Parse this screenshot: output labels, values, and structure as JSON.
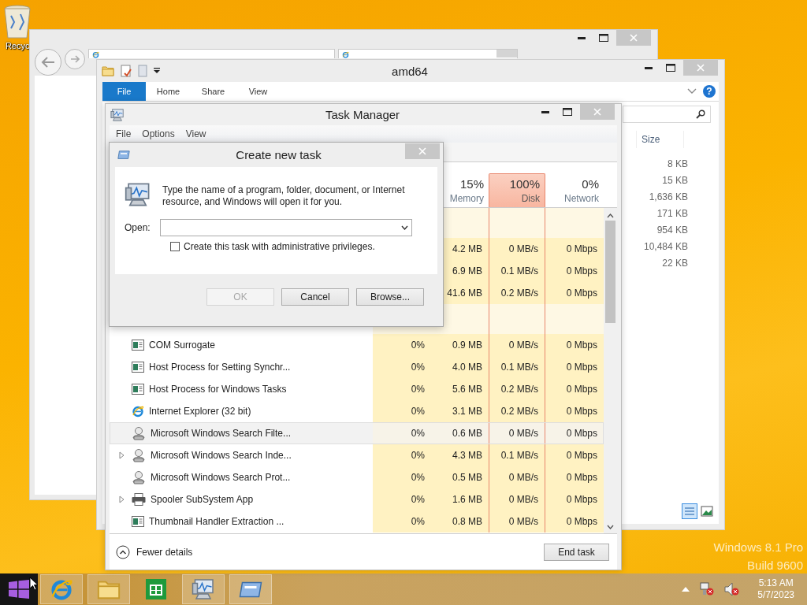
{
  "desktop": {
    "icons": [
      {
        "label": "Recyc"
      }
    ],
    "watermark": [
      "Windows 8.1 Pro",
      "Build 9600"
    ]
  },
  "explorer": {
    "title": "amd64",
    "ribbon_tabs": [
      {
        "label": "File",
        "selected": true
      },
      {
        "label": "Home",
        "selected": false
      },
      {
        "label": "Share",
        "selected": false
      },
      {
        "label": "View",
        "selected": false
      }
    ],
    "help_button": "?",
    "size_header": "Size",
    "sizes": [
      "8 KB",
      "15 KB",
      "1,636 KB",
      "171 KB",
      "954 KB",
      "10,484 KB",
      "22 KB"
    ]
  },
  "task_manager": {
    "title": "Task Manager",
    "menu": [
      "File",
      "Options",
      "View"
    ],
    "columns": [
      {
        "percent": "15%",
        "label": "Memory",
        "highlighted": false
      },
      {
        "percent": "100%",
        "label": "Disk",
        "highlighted": true
      },
      {
        "percent": "0%",
        "label": "Network",
        "highlighted": false
      }
    ],
    "groups": [
      {
        "rows": [
          {
            "selected": false,
            "memory": "4.2 MB",
            "disk": "0 MB/s",
            "network": "0 Mbps"
          },
          {
            "selected": false,
            "memory": "6.9 MB",
            "disk": "0.1 MB/s",
            "network": "0 Mbps"
          },
          {
            "selected": false,
            "memory": "41.6 MB",
            "disk": "0.2 MB/s",
            "network": "0 Mbps"
          }
        ]
      },
      {
        "rows": [
          {
            "name": "COM Surrogate",
            "kind": "app",
            "expandable": false,
            "selected": false,
            "cpu": "0%",
            "memory": "0.9 MB",
            "disk": "0 MB/s",
            "network": "0 Mbps"
          },
          {
            "name": "Host Process for Setting Synchr...",
            "kind": "app",
            "expandable": false,
            "selected": false,
            "cpu": "0%",
            "memory": "4.0 MB",
            "disk": "0.1 MB/s",
            "network": "0 Mbps"
          },
          {
            "name": "Host Process for Windows Tasks",
            "kind": "app",
            "expandable": false,
            "selected": false,
            "cpu": "0%",
            "memory": "5.6 MB",
            "disk": "0.2 MB/s",
            "network": "0 Mbps"
          },
          {
            "name": "Internet Explorer (32 bit)",
            "kind": "browser",
            "expandable": false,
            "selected": false,
            "cpu": "0%",
            "memory": "3.1 MB",
            "disk": "0.2 MB/s",
            "network": "0 Mbps"
          },
          {
            "name": "Microsoft Windows Search Filte...",
            "kind": "search",
            "expandable": false,
            "selected": true,
            "cpu": "0%",
            "memory": "0.6 MB",
            "disk": "0 MB/s",
            "network": "0 Mbps"
          },
          {
            "name": "Microsoft Windows Search Inde...",
            "kind": "search",
            "expandable": true,
            "selected": false,
            "cpu": "0%",
            "memory": "4.3 MB",
            "disk": "0.1 MB/s",
            "network": "0 Mbps"
          },
          {
            "name": "Microsoft Windows Search Prot...",
            "kind": "search",
            "expandable": false,
            "selected": false,
            "cpu": "0%",
            "memory": "0.5 MB",
            "disk": "0 MB/s",
            "network": "0 Mbps"
          },
          {
            "name": "Spooler SubSystem App",
            "kind": "printer",
            "expandable": true,
            "selected": false,
            "cpu": "0%",
            "memory": "1.6 MB",
            "disk": "0 MB/s",
            "network": "0 Mbps"
          },
          {
            "name": "Thumbnail Handler Extraction ...",
            "kind": "app",
            "expandable": false,
            "selected": false,
            "cpu": "0%",
            "memory": "0.8 MB",
            "disk": "0 MB/s",
            "network": "0 Mbps"
          }
        ]
      }
    ],
    "fewer_details": "Fewer details",
    "end_task": "End task"
  },
  "dialog": {
    "title": "Create new task",
    "message": "Type the name of a program, folder, document, or Internet resource, and Windows will open it for you.",
    "open_label": "Open:",
    "admin_checkbox": {
      "label": "Create this task with administrative privileges.",
      "checked": false
    },
    "buttons": [
      {
        "label": "OK",
        "disabled": true
      },
      {
        "label": "Cancel",
        "disabled": false
      },
      {
        "label": "Browse...",
        "disabled": false
      }
    ]
  },
  "taskbar": {
    "apps": [
      {
        "kind": "browser",
        "running": true
      },
      {
        "kind": "explorer",
        "running": true
      },
      {
        "kind": "store",
        "running": false
      },
      {
        "kind": "monitor",
        "running": true
      },
      {
        "kind": "run",
        "running": true
      }
    ],
    "clock": {
      "time": "5:13 AM",
      "date": "5/7/2023"
    }
  }
}
